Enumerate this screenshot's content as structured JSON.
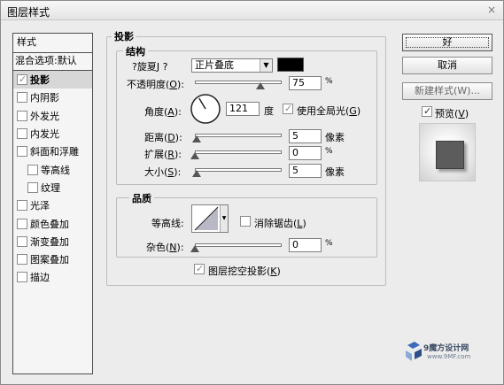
{
  "window": {
    "title": "图层样式",
    "close_glyph": "×"
  },
  "left_panel": {
    "header": "样式",
    "blend_options": "混合选项:默认",
    "items": [
      {
        "label": "投影",
        "checked": true,
        "selected": true,
        "sub": false
      },
      {
        "label": "内阴影",
        "checked": false,
        "selected": false,
        "sub": false
      },
      {
        "label": "外发光",
        "checked": false,
        "selected": false,
        "sub": false
      },
      {
        "label": "内发光",
        "checked": false,
        "selected": false,
        "sub": false
      },
      {
        "label": "斜面和浮雕",
        "checked": false,
        "selected": false,
        "sub": false
      },
      {
        "label": "等高线",
        "checked": false,
        "selected": false,
        "sub": true
      },
      {
        "label": "纹理",
        "checked": false,
        "selected": false,
        "sub": true
      },
      {
        "label": "光泽",
        "checked": false,
        "selected": false,
        "sub": false
      },
      {
        "label": "颜色叠加",
        "checked": false,
        "selected": false,
        "sub": false
      },
      {
        "label": "渐变叠加",
        "checked": false,
        "selected": false,
        "sub": false
      },
      {
        "label": "图案叠加",
        "checked": false,
        "selected": false,
        "sub": false
      },
      {
        "label": "描边",
        "checked": false,
        "selected": false,
        "sub": false
      }
    ]
  },
  "shadow": {
    "section_title": "投影",
    "structure": {
      "title": "结构",
      "blend_mode_label": "?旋夏J ?",
      "blend_mode_value": "正片叠底",
      "color": "#000000",
      "opacity": {
        "label": "不透明度",
        "key": "O",
        "value": "75",
        "unit": "%",
        "level": 0.75
      },
      "angle": {
        "label": "角度",
        "key": "A",
        "value": "121",
        "unit": "度",
        "degrees": 121
      },
      "use_global_light": {
        "label": "使用全局光",
        "key": "G",
        "checked": true
      },
      "distance": {
        "label": "距离",
        "key": "D",
        "value": "5",
        "unit": "像素",
        "level": 0.02
      },
      "spread": {
        "label": "扩展",
        "key": "R",
        "value": "0",
        "unit": "%",
        "level": 0.0
      },
      "size": {
        "label": "大小",
        "key": "S",
        "value": "5",
        "unit": "像素",
        "level": 0.02
      }
    },
    "quality": {
      "title": "品质",
      "contour_label": "等高线:",
      "anti_alias": {
        "label": "消除锯齿",
        "key": "L",
        "checked": false
      },
      "noise": {
        "label": "杂色",
        "key": "N",
        "value": "0",
        "unit": "%",
        "level": 0.0
      }
    },
    "layer_knocks_out": {
      "label": "图层挖空投影",
      "key": "K",
      "checked": true
    }
  },
  "buttons": {
    "ok": "好",
    "cancel": "取消",
    "new_style": "新建样式(W)...",
    "preview_label": "预览",
    "preview_key": "V",
    "preview_checked": true
  },
  "watermark": {
    "name": "9魔方设计网",
    "url": "www.9MF.com"
  }
}
